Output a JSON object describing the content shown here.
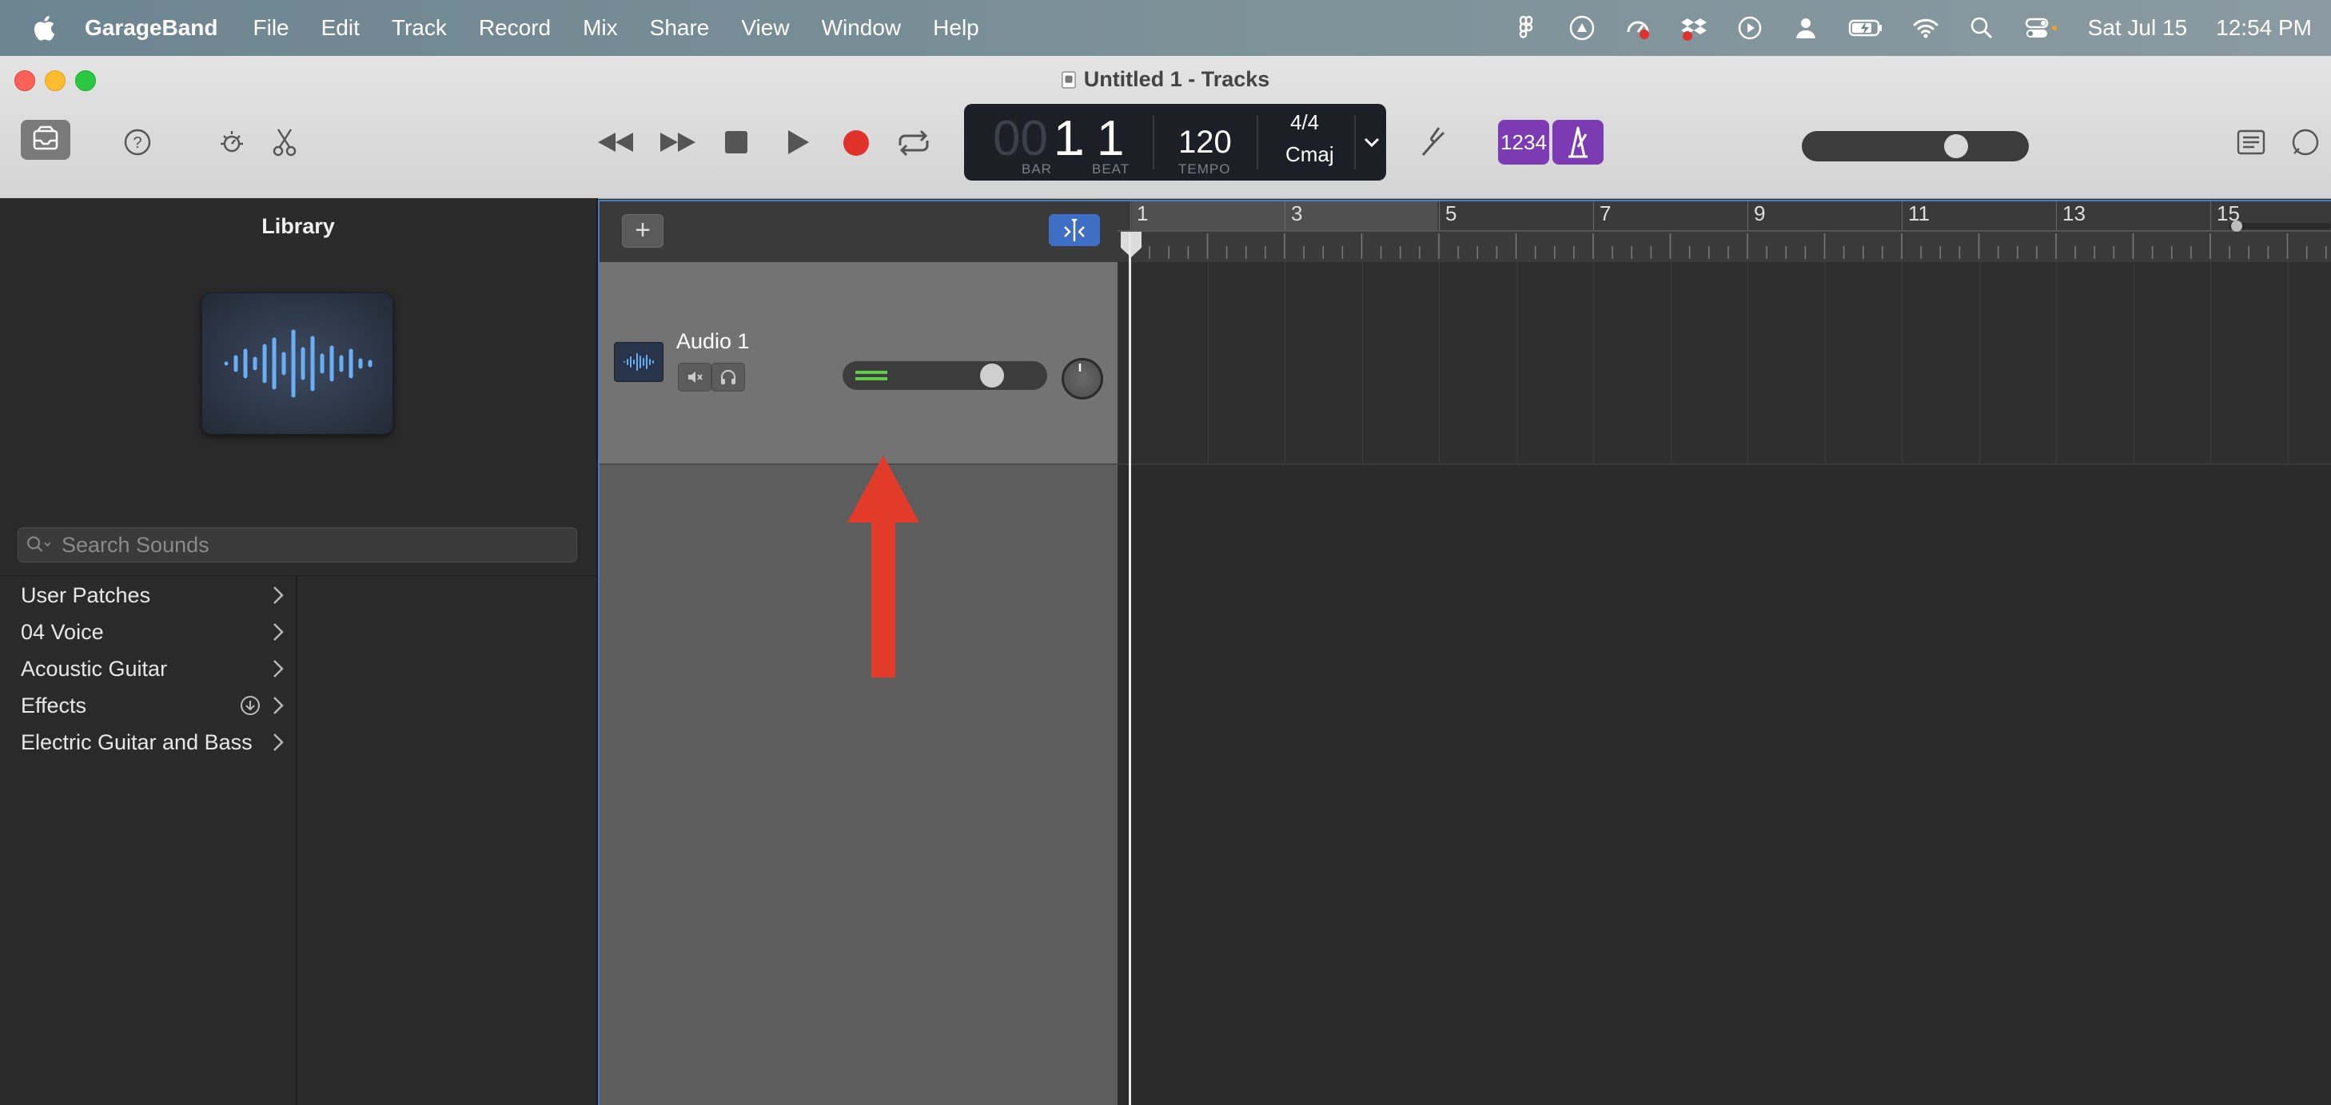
{
  "menubar": {
    "app_name": "GarageBand",
    "items": [
      "File",
      "Edit",
      "Track",
      "Record",
      "Mix",
      "Share",
      "View",
      "Window",
      "Help"
    ],
    "date": "Sat Jul 15",
    "time": "12:54 PM",
    "status_icons": [
      "figma-icon",
      "drive-icon",
      "screen-recorder-icon",
      "dropbox-icon",
      "play-circle-icon",
      "user-icon",
      "battery-icon",
      "wifi-icon",
      "search-icon",
      "control-center-icon"
    ]
  },
  "window": {
    "title": "Untitled 1 - Tracks"
  },
  "lcd": {
    "bar": "1",
    "beat": "1",
    "bar_prefix": "00",
    "bar_label": "BAR",
    "beat_label": "BEAT",
    "tempo": "120",
    "tempo_label": "TEMPO",
    "time_signature": "4/4",
    "key": "Cmaj"
  },
  "toolbar": {
    "count_in_label": "1234"
  },
  "library": {
    "title": "Library",
    "search_placeholder": "Search Sounds",
    "items": [
      {
        "label": "User Patches",
        "download": false
      },
      {
        "label": "04 Voice",
        "download": false
      },
      {
        "label": "Acoustic Guitar",
        "download": false
      },
      {
        "label": "Effects",
        "download": true
      },
      {
        "label": "Electric Guitar and Bass",
        "download": false
      }
    ]
  },
  "tracks": [
    {
      "name": "Audio 1",
      "volume": 0.7
    }
  ],
  "ruler": {
    "bars": [
      "1",
      "3",
      "5",
      "7",
      "9",
      "11",
      "13",
      "15"
    ]
  },
  "colors": {
    "record": "#e0312b",
    "accent_blue": "#3f6fc4",
    "count_in_purple": "#7d3bb3",
    "annotation_arrow": "#e23b2a",
    "meter_green": "#5ecb4a"
  }
}
